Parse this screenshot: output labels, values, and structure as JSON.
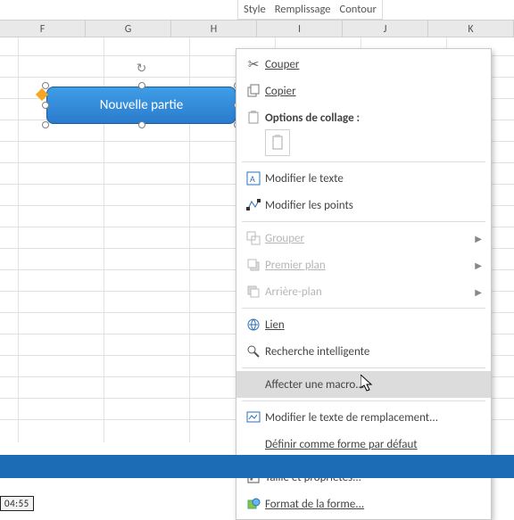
{
  "toolbar": {
    "style": "Style",
    "fill": "Remplissage",
    "outline": "Contour"
  },
  "columns": [
    "F",
    "G",
    "H",
    "I",
    "J",
    "K"
  ],
  "shape": {
    "text": "Nouvelle partie"
  },
  "menu": {
    "cut": "Couper",
    "copy": "Copier",
    "paste_options": "Options de collage :",
    "edit_text": "Modifier le texte",
    "edit_points": "Modifier les points",
    "group": "Grouper",
    "bring_front": "Premier plan",
    "send_back": "Arrière-plan",
    "link": "Lien",
    "smart_lookup": "Recherche intelligente",
    "assign_macro": "Affecter une macro...",
    "alt_text": "Modifier le texte de remplacement...",
    "set_default": "Définir comme forme par défaut",
    "size_props": "Taille et propriétés...",
    "format_shape": "Format de la forme..."
  },
  "colors": {
    "shape_a": "#3f9de6",
    "shape_b": "#2b7bcd",
    "hover": "#dcdcdc",
    "excel_blue": "#1b6cb5"
  },
  "video_time": "04:55"
}
